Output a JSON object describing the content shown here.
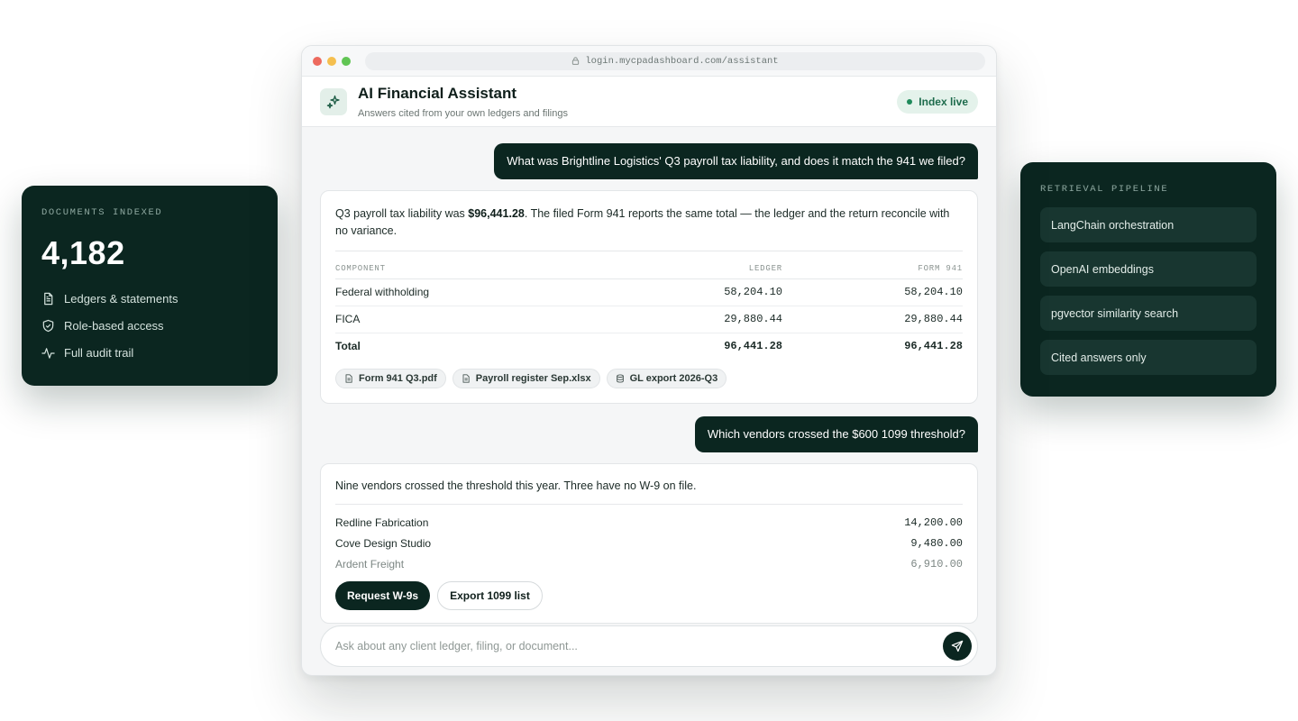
{
  "stats": {
    "eyebrow": "DOCUMENTS INDEXED",
    "count": "4,182",
    "features": [
      {
        "icon": "document-icon",
        "label": "Ledgers & statements"
      },
      {
        "icon": "shield-check-icon",
        "label": "Role-based access"
      },
      {
        "icon": "activity-icon",
        "label": "Full audit trail"
      }
    ]
  },
  "pipeline": {
    "eyebrow": "RETRIEVAL PIPELINE",
    "steps": [
      "LangChain orchestration",
      "OpenAI embeddings",
      "pgvector similarity search",
      "Cited answers only"
    ]
  },
  "browser": {
    "url": "login.mycpadashboard.com/assistant"
  },
  "header": {
    "icon": "sparkle-icon",
    "title": "AI Financial Assistant",
    "subtitle": "Answers cited from your own ledgers and filings",
    "status": "Index live"
  },
  "conversation": {
    "q1": "What was Brightline Logistics' Q3 payroll tax liability, and does it match the 941 we filed?",
    "a1": {
      "text_prefix": "Q3 payroll tax liability was ",
      "amount": "$96,441.28",
      "text_suffix": ". The filed Form 941 reports the same total — the ledger and the return reconcile with no variance.",
      "columns": [
        "COMPONENT",
        "LEDGER",
        "FORM 941"
      ],
      "rows": [
        [
          "Federal withholding",
          "58,204.10",
          "58,204.10"
        ],
        [
          "FICA",
          "29,880.44",
          "29,880.44"
        ],
        [
          "Total",
          "96,441.28",
          "96,441.28"
        ]
      ],
      "sources": [
        {
          "icon": "file-icon",
          "label": "Form 941 Q3.pdf"
        },
        {
          "icon": "file-icon",
          "label": "Payroll register Sep.xlsx"
        },
        {
          "icon": "database-icon",
          "label": "GL export 2026-Q3"
        }
      ]
    },
    "q2": "Which vendors crossed the $600 1099 threshold?",
    "a2": {
      "text": "Nine vendors crossed the threshold this year. Three have no W-9 on file.",
      "vendors": [
        {
          "name": "Redline Fabrication",
          "amount": "14,200.00"
        },
        {
          "name": "Cove Design Studio",
          "amount": "9,480.00"
        },
        {
          "name": "Ardent Freight",
          "amount": "6,910.00"
        }
      ],
      "primary_action": "Request W-9s",
      "secondary_action": "Export 1099 list"
    }
  },
  "composer": {
    "placeholder": "Ask about any client ledger, filing, or document...",
    "send_icon": "send-icon"
  },
  "colors": {
    "brand_dark": "#0b2620",
    "live_green": "#1f8a5b"
  }
}
